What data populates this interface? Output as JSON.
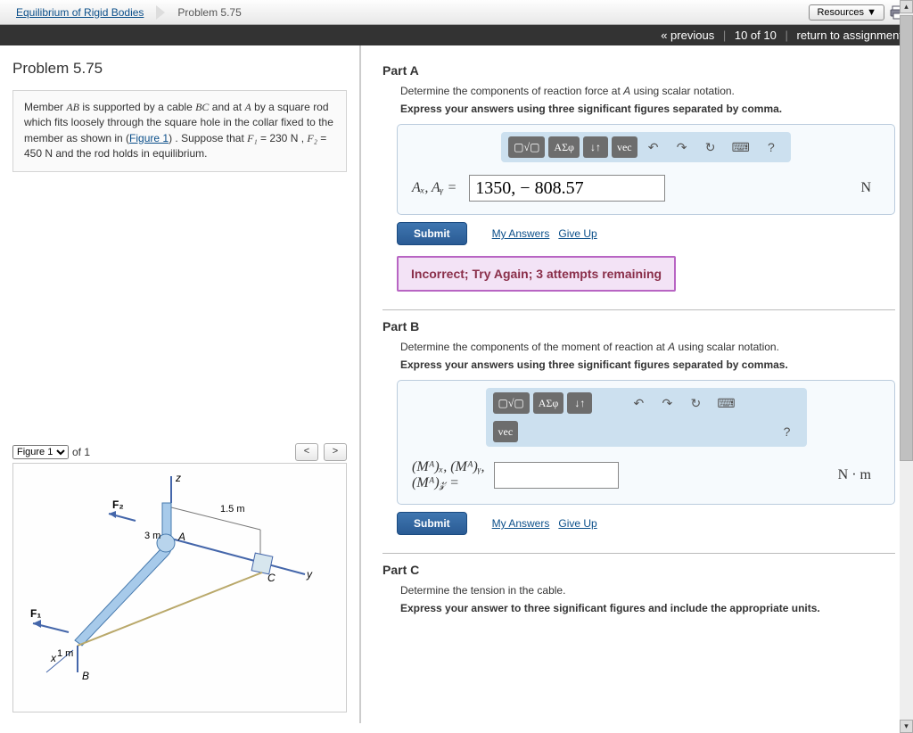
{
  "breadcrumb": {
    "root": "Equilibrium of Rigid Bodies",
    "current": "Problem 5.75"
  },
  "top": {
    "resources": "Resources ▼"
  },
  "nav": {
    "prev": "« previous",
    "counter": "10 of 10",
    "return": "return to assignment"
  },
  "problem": {
    "title": "Problem 5.75",
    "text_pre": "Member ",
    "AB": "AB",
    "text_2": " is supported by a cable ",
    "BC": "BC",
    "text_3": " and at ",
    "A1": "A",
    "text_4": " by a square rod which fits loosely through the square hole in the collar fixed to the member as shown in (",
    "fig_link": "Figure 1",
    "text_5": ") . Suppose that ",
    "F1": "F₁",
    "text_6": " = 230  N , ",
    "F2": "F₂",
    "text_7": " = 450  N and the rod holds in equilibrium."
  },
  "figure": {
    "label": "Figure 1",
    "of": "of 1"
  },
  "fig_vals": {
    "z": "z",
    "y": "y",
    "x": "x",
    "A": "A",
    "B": "B",
    "C": "C",
    "F1": "F₁",
    "F2": "F₂",
    "d15": "1.5 m",
    "d3": "3 m",
    "d1": "1 m"
  },
  "partA": {
    "head": "Part A",
    "desc": "Determine the components of reaction force at A using scalar notation.",
    "instr": "Express your answers using three significant figures separated by comma.",
    "label": "Aₓ, Aᵧ = ",
    "value": "1350, − 808.57",
    "unit": "N",
    "feedback": "Incorrect; Try Again; 3 attempts remaining"
  },
  "partB": {
    "head": "Part B",
    "desc": "Determine the components of the moment of reaction at A using scalar notation.",
    "instr": "Express your answers using three significant figures separated by commas.",
    "label": "(Mᴬ)ₓ, (Mᴬ)ᵧ,\n(Mᴬ)𝓏 = ",
    "value": "",
    "unit": "N · m"
  },
  "partC": {
    "head": "Part C",
    "desc": "Determine the tension in the cable.",
    "instr": "Express your answer to three significant figures and include the appropriate units."
  },
  "toolbar": {
    "tmpl": "▢√▢",
    "greek": "ΑΣφ",
    "updown": "↓↑",
    "vec": "vec",
    "undo": "↶",
    "redo": "↷",
    "reset": "↻",
    "keyboard": "⌨",
    "help": "?"
  },
  "buttons": {
    "submit": "Submit",
    "myanswers": "My Answers",
    "giveup": "Give Up"
  }
}
